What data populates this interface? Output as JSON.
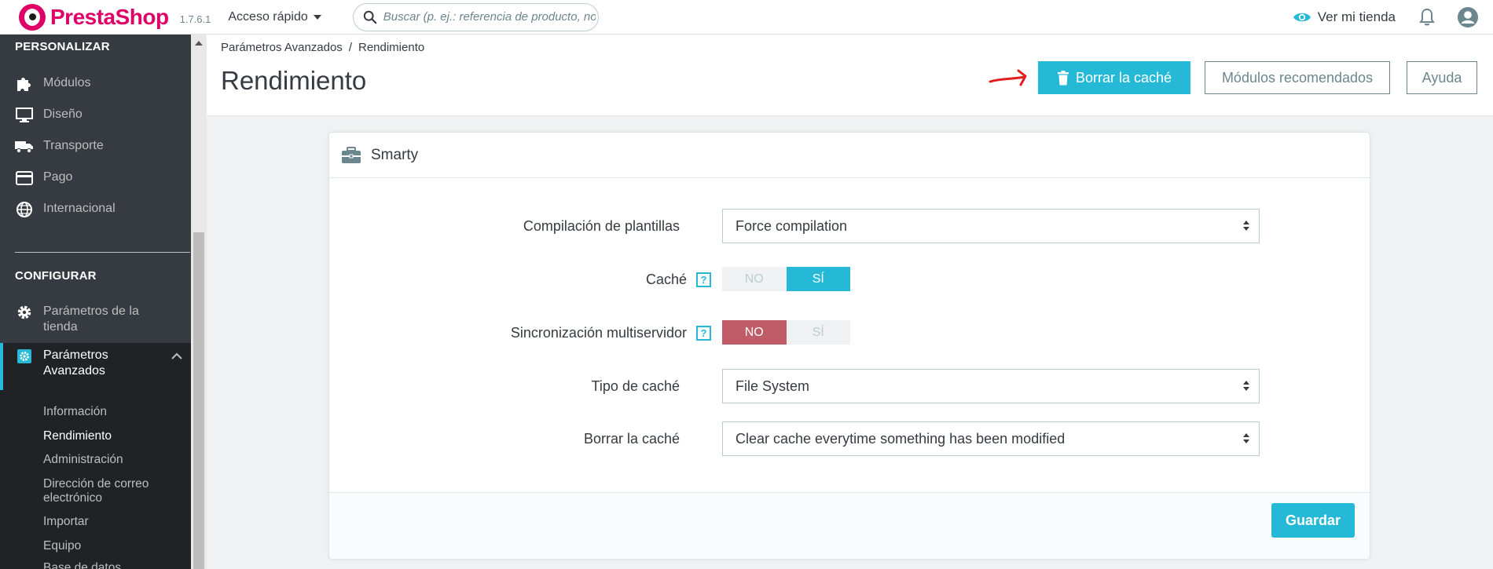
{
  "header": {
    "brand": "PrestaShop",
    "version": "1.7.6.1",
    "quick_access": "Acceso rápido",
    "search_placeholder": "Buscar (p. ej.: referencia de producto, nombre de cliente...)",
    "view_store": "Ver mi tienda"
  },
  "sidebar": {
    "section1_title": "PERSONALIZAR",
    "section1_items": [
      {
        "label": "Módulos",
        "icon": "puzzle-icon"
      },
      {
        "label": "Diseño",
        "icon": "monitor-icon"
      },
      {
        "label": "Transporte",
        "icon": "truck-icon"
      },
      {
        "label": "Pago",
        "icon": "credit-card-icon"
      },
      {
        "label": "Internacional",
        "icon": "globe-icon"
      }
    ],
    "section2_title": "CONFIGURAR",
    "store_params": "Parámetros de la tienda",
    "advanced_params": "Parámetros Avanzados",
    "sub_items": [
      "Información",
      "Rendimiento",
      "Administración",
      "Dirección de correo electrónico",
      "Importar",
      "Equipo",
      "Base de datos"
    ]
  },
  "page": {
    "breadcrumb_parent": "Parámetros Avanzados",
    "breadcrumb_current": "Rendimiento",
    "title": "Rendimiento",
    "clear_cache_button": "Borrar la caché",
    "recommended_modules_button": "Módulos recomendados",
    "help_button": "Ayuda"
  },
  "panel": {
    "title": "Smarty",
    "template_compilation_label": "Compilación de plantillas",
    "template_compilation_value": "Force compilation",
    "cache_label": "Caché",
    "multiserver_label": "Sincronización multiservidor",
    "switch_no": "NO",
    "switch_yes": "SÍ",
    "help_mark": "?",
    "cache_type_label": "Tipo de caché",
    "cache_type_value": "File System",
    "clear_cache_label": "Borrar la caché",
    "clear_cache_value": "Clear cache everytime something has been modified",
    "save_button": "Guardar"
  },
  "colors": {
    "brand_pink": "#df0067",
    "primary": "#25b9d7",
    "danger": "#c05c67",
    "sidebar_bg": "#363a41"
  }
}
